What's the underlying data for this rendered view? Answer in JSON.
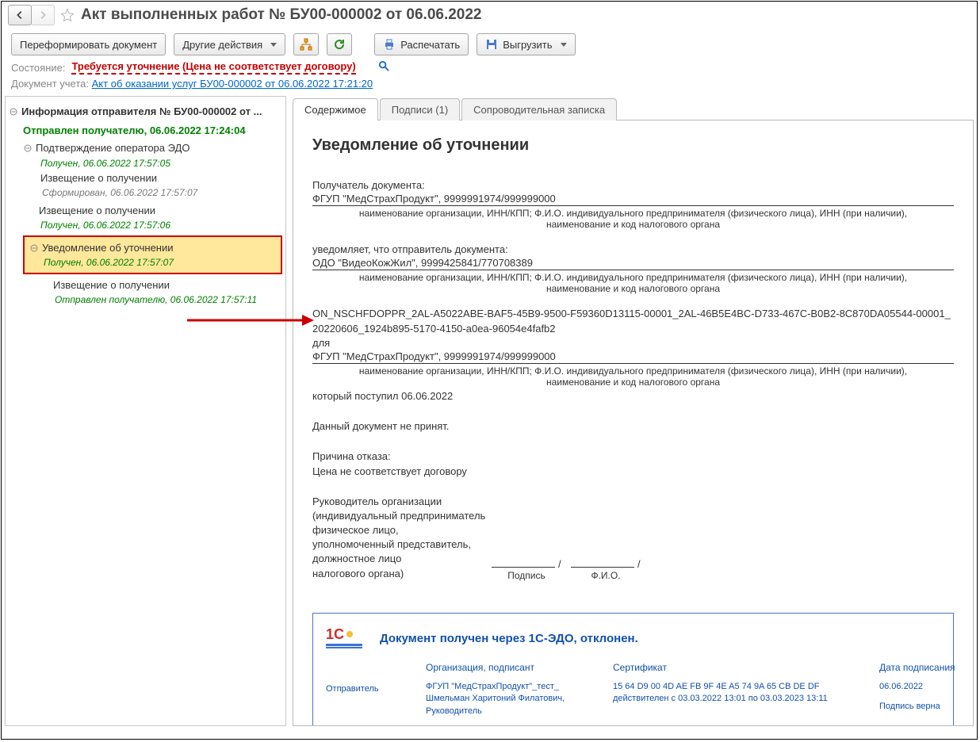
{
  "title": "Акт выполненных работ № БУ00-000002 от 06.06.2022",
  "toolbar": {
    "reform": "Переформировать документ",
    "other": "Другие действия",
    "print": "Распечатать",
    "export": "Выгрузить"
  },
  "status": {
    "label": "Состояние:",
    "value": "Требуется уточнение (Цена не соответствует договору)"
  },
  "docref": {
    "label": "Документ учета:",
    "link": "Акт об оказании услуг БУ00-000002 от 06.06.2022 17:21:20"
  },
  "tree": {
    "root": "Информация отправителя № БУ00-000002 от ...",
    "sent": "Отправлен получателю, 06.06.2022 17:24:04",
    "op_confirm": "Подтверждение оператора ЭДО",
    "op_confirm_s": "Получен, 06.06.2022 17:57:05",
    "notice1": "Извещение о получении",
    "notice1_s": "Сформирован, 06.06.2022 17:57:07",
    "notice2": "Извещение о получении",
    "notice2_s": "Получен, 06.06.2022 17:57:06",
    "clarify": "Уведомление об уточнении",
    "clarify_s": "Получен, 06.06.2022 17:57:07",
    "notice3": "Извещение о получении",
    "notice3_s": "Отправлен получателю, 06.06.2022 17:57:11"
  },
  "tabs": {
    "content": "Содержимое",
    "signs": "Подписи (1)",
    "note": "Сопроводительная записка"
  },
  "doc": {
    "heading": "Уведомление об уточнении",
    "recipient_label": "Получатель документа:",
    "recipient": "ФГУП \"МедСтрахПродукт\", 9999991974/999999000",
    "caption_org": "наименование организации, ИНН/КПП; Ф.И.О. индивидуального предпринимателя (физического лица), ИНН (при наличии), наименование и код налогового органа",
    "sender_label": "уведомляет, что отправитель документа:",
    "sender": "ОДО \"ВидеоКожЖил\", 9999425841/770708389",
    "fileid": "ON_NSCHFDOPPR_2AL-A5022ABE-BAF5-45B9-9500-F59360D13115-00001_2AL-46B5E4BC-D733-467C-B0B2-8C870DA05544-00001_20220606_1924b895-5170-4150-a0ea-96054e4fafb2",
    "for": "для",
    "for_whom": "ФГУП \"МедСтрахПродукт\", 9999991974/999999000",
    "arrived": "который поступил 06.06.2022",
    "rejected": "Данный документ не принят.",
    "reason_l": "Причина отказа:",
    "reason": "Цена не соответствует договору",
    "head1": "Руководитель  организации",
    "head2": "(индивидуальный предприниматель",
    "head3": "физическое лицо,",
    "head4": "уполномоченный представитель,",
    "head5": "должностное лицо",
    "head6": "налогового органа)",
    "sig": "Подпись",
    "fio": "Ф.И.О."
  },
  "edo": {
    "title": "Документ получен через 1С-ЭДО, отклонен.",
    "role": "Отправитель",
    "h_org": "Организация, подписант",
    "h_cert": "Сертификат",
    "h_date": "Дата подписания",
    "org": "ФГУП \"МедСтрахПродукт\"_тест_ Шмельман Харитоний Филатович, Руководитель",
    "cert": "15 64 D9 00 4D AE FB 9F 4E A5 74 9A 65 CB DE DF действителен с 03.03.2022 13:01 по 03.03.2023 13:11",
    "date": "06.06.2022",
    "valid": "Подпись верна"
  }
}
